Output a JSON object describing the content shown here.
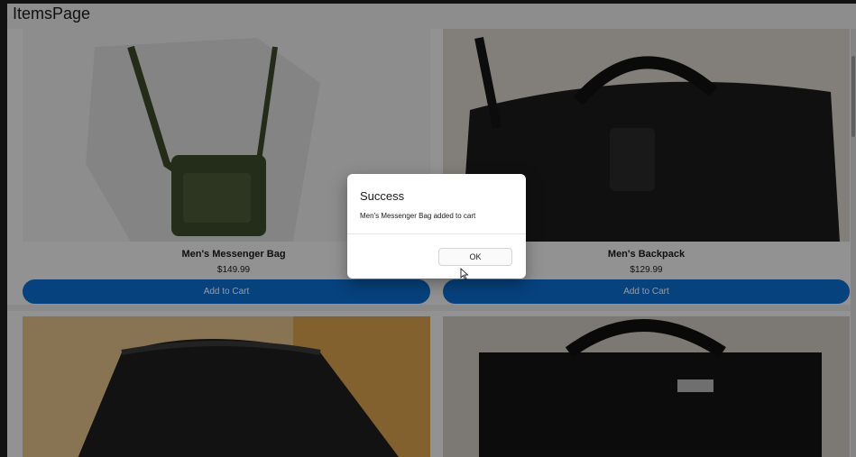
{
  "window": {
    "title": "ItemsPage"
  },
  "products": [
    {
      "name": "Men's Messenger Bag",
      "price": "$149.99",
      "button_label": "Add to Cart",
      "image_icon": "messenger-bag-photo"
    },
    {
      "name": "Men's Backpack",
      "price": "$129.99",
      "button_label": "Add to Cart",
      "image_icon": "duffel-bag-photo"
    },
    {
      "name": "",
      "price": "",
      "button_label": "",
      "image_icon": "monogram-bag-photo"
    },
    {
      "name": "",
      "price": "",
      "button_label": "",
      "image_icon": "black-handbag-photo"
    }
  ],
  "dialog": {
    "title": "Success",
    "message": "Men's Messenger Bag added to cart",
    "ok_label": "OK"
  },
  "colors": {
    "accent": "#0a6fd2",
    "overlay": "rgba(0,0,0,0.40)"
  }
}
